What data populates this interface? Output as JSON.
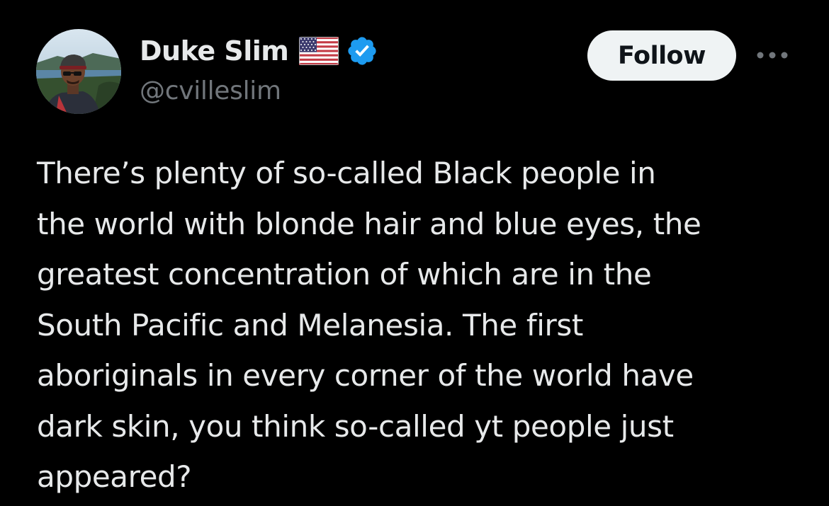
{
  "author": {
    "display_name": "Duke Slim",
    "handle": "@cvilleslim",
    "flag_icon": "us-flag-icon",
    "verified_icon": "verified-badge-icon",
    "verified_color": "#1d9bf0"
  },
  "actions": {
    "follow_label": "Follow",
    "more_icon": "more-horizontal-icon"
  },
  "tweet": {
    "lines": [
      "There’s plenty of so-called Black people in",
      "the world with blonde hair and blue eyes, the",
      "greatest concentration of which are in the",
      "South Pacific and Melanesia. The first",
      "aboriginals in every corner of the world have",
      "dark skin, you think so-called yt people just",
      "appeared?"
    ]
  },
  "colors": {
    "background": "#000000",
    "text_primary": "#e7e9ea",
    "text_secondary": "#71767b",
    "follow_bg": "#eff3f4",
    "follow_text": "#0f1419"
  }
}
